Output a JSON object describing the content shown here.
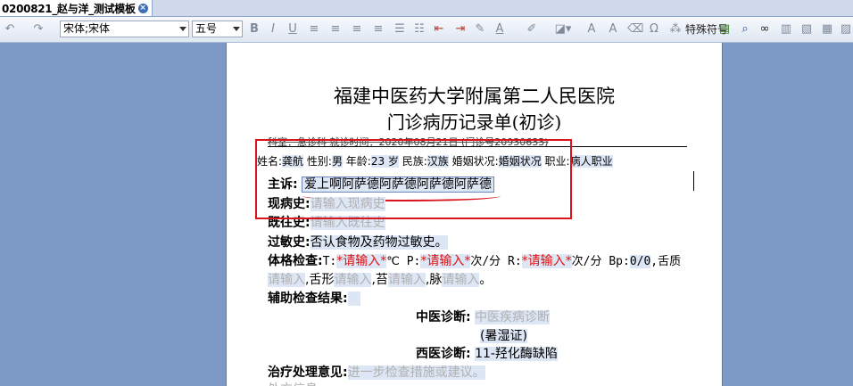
{
  "tab": {
    "label": "0200821_赵与洋_测试模板"
  },
  "toolbar": {
    "font_name": "宋体;宋体",
    "font_size": "五号",
    "special_chars": "特殊符号"
  },
  "doc": {
    "title": "福建中医药大学附属第二人民医院",
    "subtitle": "门诊病历记录单(初诊)",
    "info_line": "科室：急诊科  就诊时间：2020年08月21日  (门诊号20930633)",
    "patient": {
      "name_label": "姓名:",
      "name": "龚航",
      "sex_label": "性别:",
      "sex": "男",
      "age_label": "年龄:",
      "age": "23 岁",
      "ethnic_label": "民族:",
      "ethnic": "汉族",
      "marital_label": "婚姻状况:",
      "marital": "婚姻状况",
      "job_label": "职业:",
      "job": "病人职业"
    },
    "complaint_label": "主诉:",
    "complaint": "爱上啊阿萨德阿萨德阿萨德阿萨德",
    "present_label": "现病史:",
    "present_ph": "请输入现病史",
    "past_label": "既往史:",
    "past_ph": "请输入既往史",
    "allergy_label": "过敏史:",
    "allergy": "否认食物及药物过敏史。",
    "exam_label": "体格检查:",
    "exam_t": "T:",
    "exam_t_val": "*请输入*",
    "exam_t_unit": "℃ P:",
    "exam_p_val": "*请输入*",
    "exam_p_unit": "次/分 R:",
    "exam_r_val": "*请输入*",
    "exam_r_unit": "次/分 Bp:",
    "exam_bp": "0/0",
    "exam_tongue_label": ",舌质",
    "line2_ph1": "请输入",
    "line2_t1": ",舌形",
    "line2_ph2": "请输入",
    "line2_t2": ",苔",
    "line2_ph3": "请输入",
    "line2_t3": ",脉",
    "line2_ph4": "请输入",
    "line2_end": "。",
    "aux_label": "辅助检查结果:",
    "tcm_label": "中医诊断:",
    "tcm_ph": "中医疾病诊断",
    "tcm_sub": "(暑湿证)",
    "wm_label": "西医诊断:",
    "wm": "11-羟化酶缺陷",
    "treat_label": "治疗处理意见:",
    "treat_ph": "进一步检查措施或建议。",
    "more": "处方信息"
  }
}
